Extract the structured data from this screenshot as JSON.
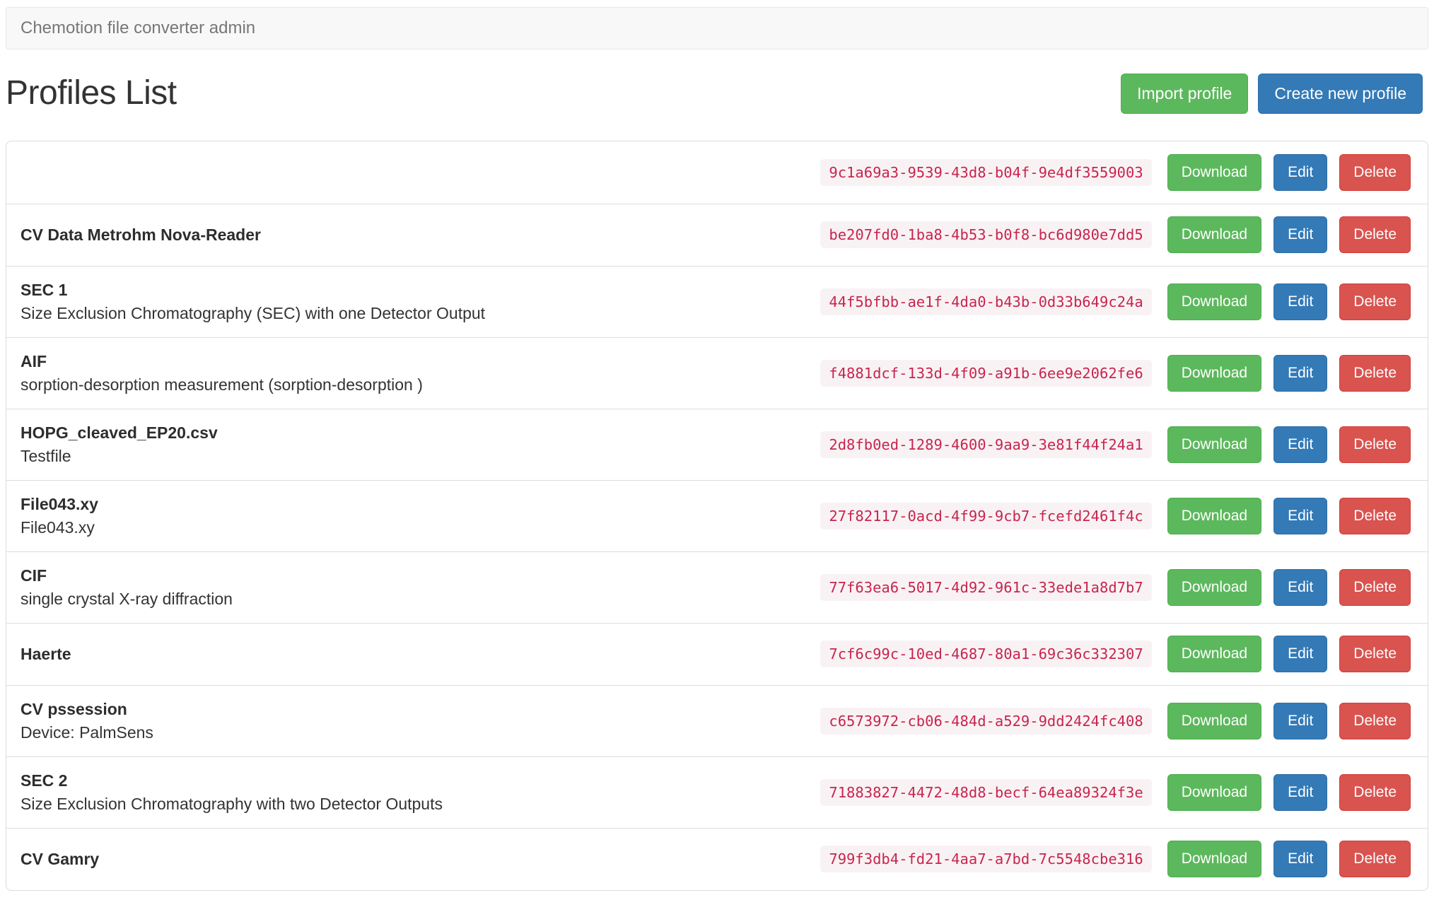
{
  "navbar": {
    "brand": "Chemotion file converter admin"
  },
  "header": {
    "title": "Profiles List",
    "import_button": "Import profile",
    "create_button": "Create new profile"
  },
  "actions": {
    "download": "Download",
    "edit": "Edit",
    "delete": "Delete"
  },
  "colors": {
    "success_green": "#5cb85c",
    "primary_blue": "#337ab7",
    "danger_red": "#d9534f",
    "code_text": "#c7254e",
    "code_background": "#f9f2f4",
    "navbar_background": "#f8f8f8",
    "border": "#dddddd"
  },
  "profiles": [
    {
      "title": "",
      "description": "",
      "uuid": "9c1a69a3-9539-43d8-b04f-9e4df3559003"
    },
    {
      "title": "CV Data Metrohm Nova-Reader",
      "description": "",
      "uuid": "be207fd0-1ba8-4b53-b0f8-bc6d980e7dd5"
    },
    {
      "title": "SEC 1",
      "description": "Size Exclusion Chromatography (SEC) with one Detector Output",
      "uuid": "44f5bfbb-ae1f-4da0-b43b-0d33b649c24a"
    },
    {
      "title": "AIF",
      "description": "sorption-desorption measurement (sorption-desorption )",
      "uuid": "f4881dcf-133d-4f09-a91b-6ee9e2062fe6"
    },
    {
      "title": "HOPG_cleaved_EP20.csv",
      "description": "Testfile",
      "uuid": "2d8fb0ed-1289-4600-9aa9-3e81f44f24a1"
    },
    {
      "title": "File043.xy",
      "description": "File043.xy",
      "uuid": "27f82117-0acd-4f99-9cb7-fcefd2461f4c"
    },
    {
      "title": "CIF",
      "description": "single crystal X-ray diffraction",
      "uuid": "77f63ea6-5017-4d92-961c-33ede1a8d7b7"
    },
    {
      "title": "Haerte",
      "description": "",
      "uuid": "7cf6c99c-10ed-4687-80a1-69c36c332307"
    },
    {
      "title": "CV pssession",
      "description": "Device: PalmSens",
      "uuid": "c6573972-cb06-484d-a529-9dd2424fc408"
    },
    {
      "title": "SEC 2",
      "description": "Size Exclusion Chromatography with two Detector Outputs",
      "uuid": "71883827-4472-48d8-becf-64ea89324f3e"
    },
    {
      "title": "CV Gamry",
      "description": "",
      "uuid": "799f3db4-fd21-4aa7-a7bd-7c5548cbe316"
    }
  ]
}
